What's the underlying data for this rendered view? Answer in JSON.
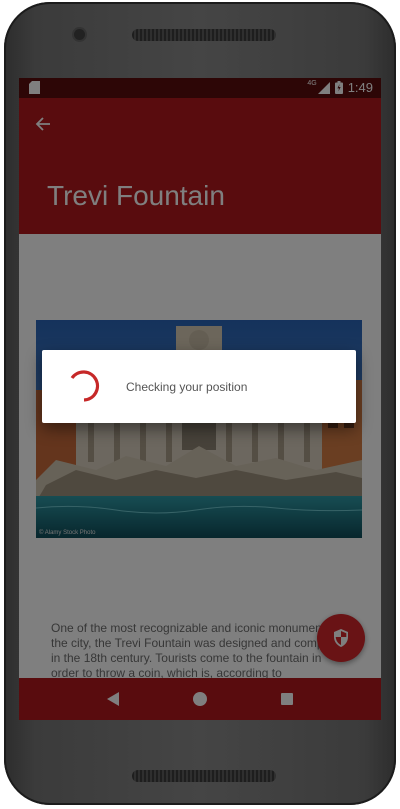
{
  "status_bar": {
    "network": "4G",
    "time": "1:49"
  },
  "app_bar": {
    "title": "Trevi Fountain"
  },
  "content": {
    "image_credit": "© Alamy Stock Photo",
    "description": "One of the most recognizable and iconic monuments in the city, the Trevi Fountain was designed and completed in the 18th century. Tourists come to the fountain in order to throw a coin, which is, according to"
  },
  "dialog": {
    "message": "Checking your position"
  },
  "colors": {
    "primary": "#b3191c",
    "status_bar": "#5a0d0d",
    "fab": "#d3262a",
    "spinner": "#c62828"
  },
  "icons": {
    "back": "arrow-back-icon",
    "fab": "shield-icon",
    "nav_back": "triangle-back-icon",
    "nav_home": "circle-home-icon",
    "nav_recents": "square-recents-icon"
  }
}
